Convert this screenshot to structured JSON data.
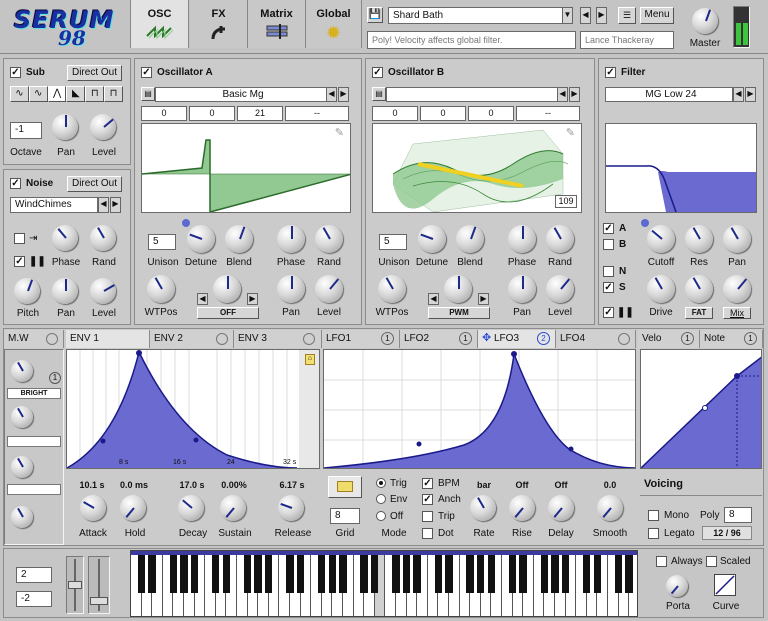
{
  "app": {
    "logo_line1": "SERUM",
    "logo_line2": "98",
    "master_label": "Master"
  },
  "tabs": [
    {
      "label": "OSC",
      "icon": "osc-wave-icon"
    },
    {
      "label": "FX",
      "icon": "fx-plug-icon"
    },
    {
      "label": "Matrix",
      "icon": "matrix-icon"
    },
    {
      "label": "Global",
      "icon": "gear-icon"
    }
  ],
  "preset": {
    "name": "Shard Bath",
    "description": "Poly! Velocity affects global filter.",
    "author": "Lance Thackeray",
    "menu_label": "Menu"
  },
  "sub": {
    "title": "Sub",
    "direct_out": "Direct Out",
    "octave_value": "-1",
    "labels": [
      "Octave",
      "Pan",
      "Level"
    ]
  },
  "noise": {
    "title": "Noise",
    "direct_out": "Direct Out",
    "sample": "WindChimes",
    "labels": [
      "Phase",
      "Rand",
      "Pitch",
      "Pan",
      "Level"
    ]
  },
  "osc_a": {
    "title": "Oscillator A",
    "wavetable": "Basic Mg",
    "fields": [
      "0",
      "0",
      "21",
      "--"
    ],
    "unison": "5",
    "labels": [
      "Unison",
      "Detune",
      "Blend",
      "Phase",
      "Rand",
      "WTPos",
      "Pan",
      "Level"
    ],
    "warp": "OFF"
  },
  "osc_b": {
    "title": "Oscillator B",
    "wavetable": "",
    "fields": [
      "0",
      "0",
      "0",
      "--"
    ],
    "frame": "109",
    "unison": "5",
    "labels": [
      "Unison",
      "Detune",
      "Blend",
      "Phase",
      "Rand",
      "WTPos",
      "Pan",
      "Level"
    ],
    "warp": "PWM"
  },
  "filter": {
    "title": "Filter",
    "type": "MG Low 24",
    "routes": [
      "A",
      "B",
      "N",
      "S"
    ],
    "labels": [
      "Cutoff",
      "Res",
      "Pan",
      "Drive",
      "FAT",
      "Mix"
    ]
  },
  "mod_tabs": {
    "mw": "M.W",
    "env": [
      "ENV 1",
      "ENV 2",
      "ENV 3"
    ],
    "lfo": [
      "LFO1",
      "LFO2",
      "LFO3",
      "LFO4"
    ],
    "lfo_counts": [
      "1",
      "1",
      "2",
      ""
    ],
    "velo": "Velo",
    "velo_count": "1",
    "note": "Note",
    "note_count": "1",
    "bright": "BRIGHT",
    "mw_count": "1"
  },
  "env": {
    "values": [
      "10.1 s",
      "0.0 ms",
      "17.0 s",
      "0.00%",
      "6.17 s"
    ],
    "labels": [
      "Attack",
      "Hold",
      "Decay",
      "Sustain",
      "Release"
    ],
    "ticks": [
      "8 s",
      "16 s",
      "24",
      "32 s"
    ]
  },
  "lfo": {
    "grid": "8",
    "grid_label": "Grid",
    "modes": [
      "Trig",
      "Env",
      "Off"
    ],
    "mode_label": "Mode",
    "bpm": "BPM",
    "anch": "Anch",
    "trip": "Trip",
    "dot": "Dot",
    "values": [
      "bar",
      "Off",
      "Off",
      "0.0"
    ],
    "labels": [
      "Rate",
      "Rise",
      "Delay",
      "Smooth"
    ]
  },
  "voicing": {
    "title": "Voicing",
    "mono": "Mono",
    "poly": "Poly",
    "poly_value": "8",
    "legato": "Legato",
    "legato_value": "12 / 96",
    "always": "Always",
    "scaled": "Scaled",
    "porta": "Porta",
    "curve": "Curve"
  },
  "bottom": {
    "pitch_up": "2",
    "pitch_down": "-2"
  }
}
